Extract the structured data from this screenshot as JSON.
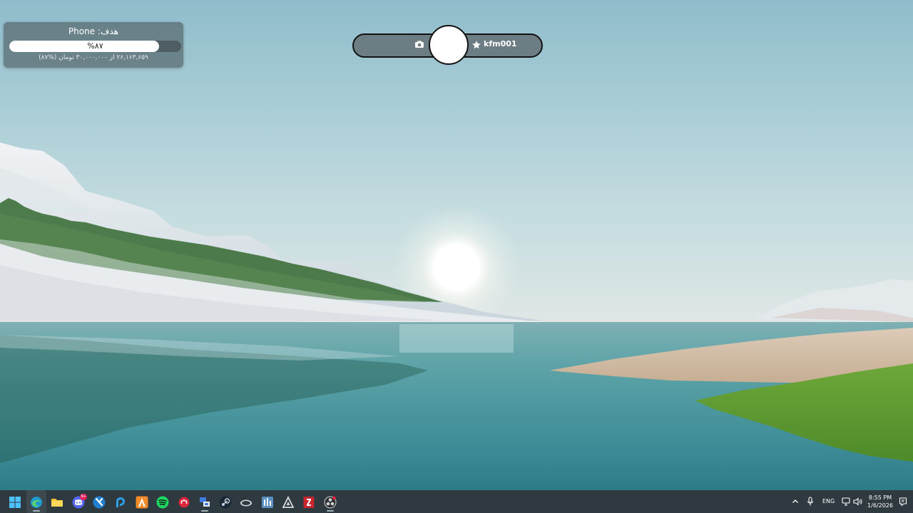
{
  "goal": {
    "title": "هدف: Phone",
    "progress_fraction": 0.87,
    "percent_label": "%۸۷",
    "subtitle": "۲۶,۱۶۳,۶۵۹ از ۳۰,۰۰۰,۰۰۰ تومان (%۸۷)"
  },
  "stream": {
    "username": "kfm001",
    "camera_icon": "camera-icon",
    "star_icon": "star-icon"
  },
  "taskbar": {
    "apps": [
      {
        "name": "windows-start-icon"
      },
      {
        "name": "edge-icon"
      },
      {
        "name": "file-explorer-icon"
      },
      {
        "name": "discord-icon",
        "badge": "9+"
      },
      {
        "name": "vscode-icon"
      },
      {
        "name": "telegram-icon"
      },
      {
        "name": "arch-app-icon"
      },
      {
        "name": "spotify-icon"
      },
      {
        "name": "red-app-icon"
      },
      {
        "name": "network-app-icon"
      },
      {
        "name": "steam-icon"
      },
      {
        "name": "gamepad-app-icon"
      },
      {
        "name": "bars-app-icon"
      },
      {
        "name": "triangle-app-icon"
      },
      {
        "name": "filezilla-icon"
      },
      {
        "name": "obs-icon"
      }
    ],
    "tray": {
      "language": "ENG",
      "time": "8:55 PM",
      "date": "1/6/2026"
    }
  }
}
